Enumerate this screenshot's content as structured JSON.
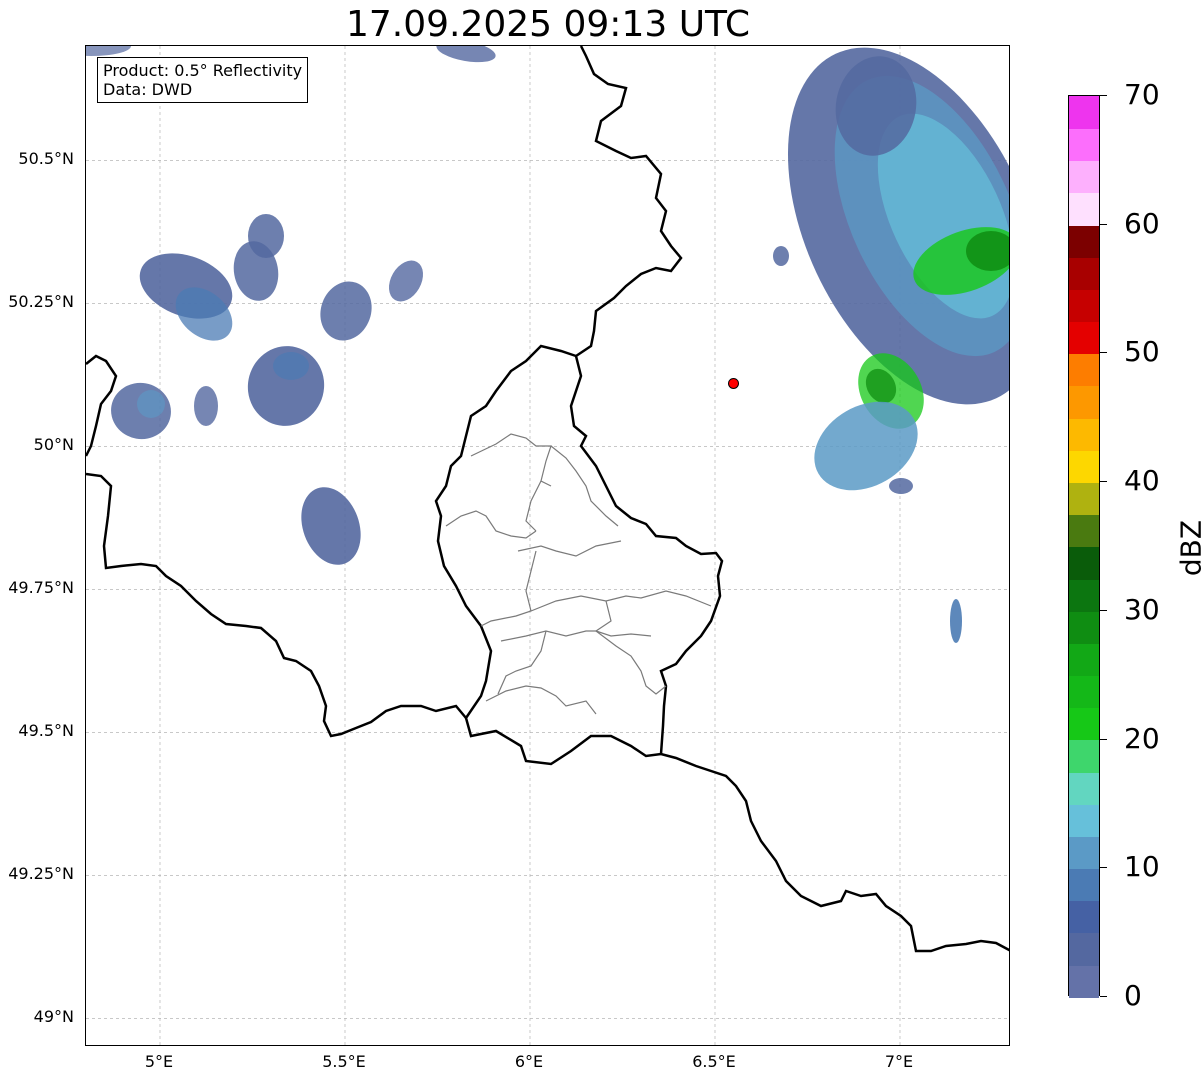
{
  "title": "17.09.2025 09:13 UTC",
  "info": {
    "product": "Product: 0.5° Reflectivity",
    "data": "Data: DWD"
  },
  "map": {
    "lon_range": [
      4.8,
      7.3
    ],
    "lat_range": [
      48.95,
      50.7
    ],
    "lat_ticks": [
      "50.5°N",
      "50.25°N",
      "50°N",
      "49.75°N",
      "49.5°N",
      "49.25°N",
      "49°N"
    ],
    "lat_tick_values": [
      50.5,
      50.25,
      50.0,
      49.75,
      49.5,
      49.25,
      49.0
    ],
    "lon_ticks": [
      "5°E",
      "5.5°E",
      "6°E",
      "6.5°E",
      "7°E"
    ],
    "lon_tick_values": [
      5.0,
      5.5,
      6.0,
      6.5,
      7.0
    ],
    "gridlines": true,
    "radar_site_color": "#ff0000",
    "radar_site": {
      "lon": 6.55,
      "lat": 50.11
    }
  },
  "colorbar": {
    "label": "dBZ",
    "min": 0,
    "max": 70,
    "step": 2.5,
    "tick_labels": [
      "0",
      "10",
      "20",
      "30",
      "40",
      "50",
      "60",
      "70"
    ],
    "tick_values": [
      0,
      10,
      20,
      30,
      40,
      50,
      60,
      70
    ],
    "colors": [
      "#6472a8",
      "#5468a0",
      "#4561a4",
      "#4b7bb4",
      "#5b9ac6",
      "#66c0da",
      "#62d6c0",
      "#3ed66c",
      "#16c817",
      "#14b818",
      "#12a816",
      "#0f8d12",
      "#0c7610",
      "#0a5c0a",
      "#4a7a10",
      "#afb210",
      "#fdd700",
      "#fdb900",
      "#fd9800",
      "#fd7d00",
      "#e40000",
      "#c60000",
      "#a80000",
      "#7c0000",
      "#fee0fe",
      "#fdb0fd",
      "#fc6efc",
      "#ee34ee"
    ]
  },
  "echo_colors": {
    "weak": "#5468a0",
    "light": "#4b7bb4",
    "moderate": "#5b9ac6",
    "cyan": "#66c0da",
    "green": "#16c817",
    "darkgreen": "#0f8d12"
  }
}
